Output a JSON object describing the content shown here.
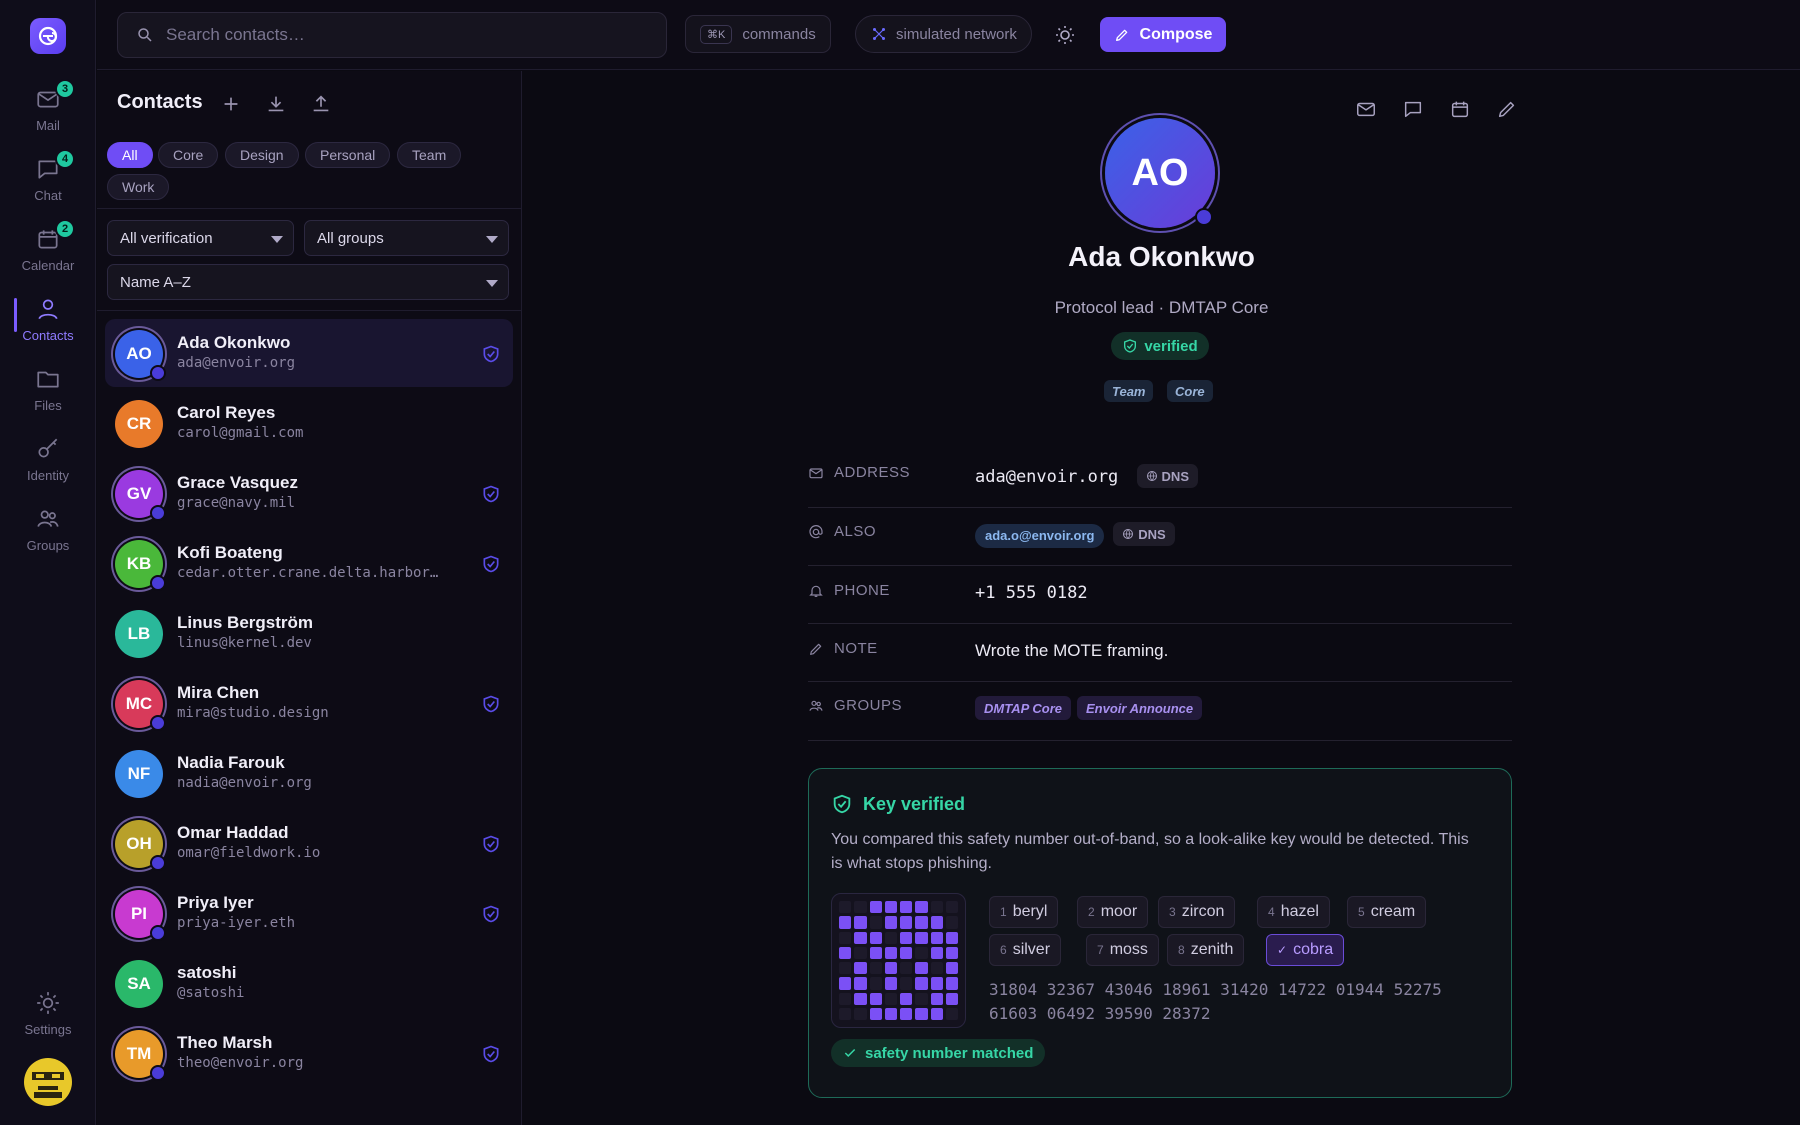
{
  "nav": {
    "items": [
      {
        "label": "Mail",
        "badge": "3",
        "icon": "mail-icon"
      },
      {
        "label": "Chat",
        "badge": "4",
        "icon": "chat-icon"
      },
      {
        "label": "Calendar",
        "badge": "2",
        "icon": "calendar-icon"
      },
      {
        "label": "Contacts",
        "icon": "person-icon",
        "active": true
      },
      {
        "label": "Files",
        "icon": "folder-icon"
      },
      {
        "label": "Identity",
        "icon": "key-icon"
      },
      {
        "label": "Groups",
        "icon": "people-icon"
      }
    ],
    "settings_label": "Settings"
  },
  "topbar": {
    "search_placeholder": "Search contacts…",
    "commands_kbd": "⌘K",
    "commands_label": "commands",
    "network_label": "simulated network",
    "compose_label": "Compose"
  },
  "contacts_panel": {
    "title": "Contacts",
    "filters": [
      "All",
      "Core",
      "Design",
      "Personal",
      "Team",
      "Work"
    ],
    "active_filter": "All",
    "verification_select": "All verification",
    "groups_select": "All groups",
    "sort_select": "Name A–Z",
    "contacts": [
      {
        "initials": "AO",
        "name": "Ada Okonkwo",
        "address": "ada@envoir.org",
        "verified": true,
        "color": "#3a62e8"
      },
      {
        "initials": "CR",
        "name": "Carol Reyes",
        "address": "carol@gmail.com",
        "verified": false,
        "color": "#e87a2a"
      },
      {
        "initials": "GV",
        "name": "Grace Vasquez",
        "address": "grace@navy.mil",
        "verified": true,
        "color": "#9a3ae0"
      },
      {
        "initials": "KB",
        "name": "Kofi Boateng",
        "address": "cedar.otter.crane.delta.harbor…",
        "verified": true,
        "color": "#4ab83a"
      },
      {
        "initials": "LB",
        "name": "Linus Bergström",
        "address": "linus@kernel.dev",
        "verified": false,
        "color": "#2ab89a"
      },
      {
        "initials": "MC",
        "name": "Mira Chen",
        "address": "mira@studio.design",
        "verified": true,
        "color": "#d83a5a"
      },
      {
        "initials": "NF",
        "name": "Nadia Farouk",
        "address": "nadia@envoir.org",
        "verified": false,
        "color": "#3a8ae8"
      },
      {
        "initials": "OH",
        "name": "Omar Haddad",
        "address": "omar@fieldwork.io",
        "verified": true,
        "color": "#b8a02a"
      },
      {
        "initials": "PI",
        "name": "Priya Iyer",
        "address": "priya-iyer.eth",
        "verified": true,
        "color": "#c83ad0"
      },
      {
        "initials": "SA",
        "name": "satoshi",
        "address": "@satoshi",
        "verified": false,
        "color": "#2ab86a"
      },
      {
        "initials": "TM",
        "name": "Theo Marsh",
        "address": "theo@envoir.org",
        "verified": true,
        "color": "#e89a2a"
      }
    ]
  },
  "detail": {
    "initials": "AO",
    "name": "Ada Okonkwo",
    "role": "Protocol lead · DMTAP Core",
    "status": "verified",
    "tags": [
      "Team",
      "Core"
    ],
    "fields": {
      "address_label": "ADDRESS",
      "address_value": "ada@envoir.org",
      "dns_label": "DNS",
      "also_label": "ALSO",
      "also_value": "ada.o@envoir.org",
      "phone_label": "PHONE",
      "phone_value": "+1 555 0182",
      "note_label": "NOTE",
      "note_value": "Wrote the MOTE framing.",
      "groups_label": "GROUPS",
      "groups": [
        "DMTAP Core",
        "Envoir Announce"
      ]
    },
    "key": {
      "title": "Key verified",
      "description": "You compared this safety number out-of-band, so a look-alike key would be detected. This is what stops phishing.",
      "words": [
        {
          "n": "1",
          "w": "beryl"
        },
        {
          "n": "2",
          "w": "moor"
        },
        {
          "n": "3",
          "w": "zircon"
        },
        {
          "n": "4",
          "w": "hazel"
        },
        {
          "n": "5",
          "w": "cream"
        },
        {
          "n": "6",
          "w": "silver"
        },
        {
          "n": "7",
          "w": "moss"
        },
        {
          "n": "8",
          "w": "zenith"
        },
        {
          "n": "✓",
          "w": "cobra"
        }
      ],
      "digits_line1": "31804 32367 43046 18961 31420 14722 01944 52275",
      "digits_line2": "61603 06492 39590 28372",
      "match_label": "safety number matched"
    }
  },
  "colors": {
    "accent": "#6f4df5",
    "verified": "#36d6a6",
    "badge": "#1fc9a0"
  }
}
